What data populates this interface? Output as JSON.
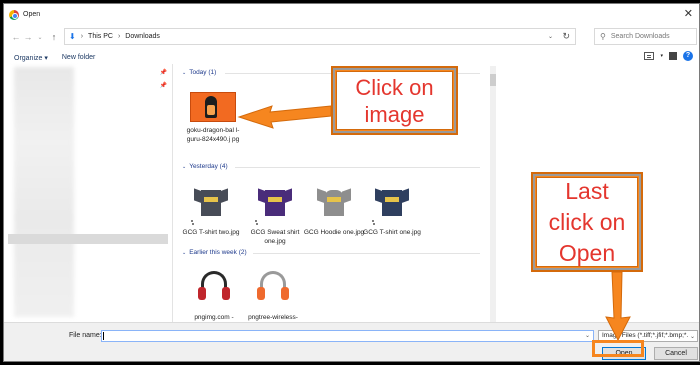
{
  "window": {
    "title": "Open"
  },
  "address": {
    "crumbs": [
      "This PC",
      "Downloads"
    ],
    "search_placeholder": "Search Downloads"
  },
  "toolbar": {
    "organize": "Organize",
    "new_folder": "New folder"
  },
  "groups": [
    {
      "label": "Today (1)"
    },
    {
      "label": "Yesterday (4)"
    },
    {
      "label": "Earlier this week (2)"
    }
  ],
  "files": {
    "today": [
      {
        "name": "goku-dragon-bal l-guru-824x490.j pg"
      }
    ],
    "yesterday": [
      {
        "name": "GCG T-shirt two.jpg",
        "color": "#474c57"
      },
      {
        "name": "GCG Sweat shirt one.jpg",
        "color": "#4a2c7a"
      },
      {
        "name": "GCG Hoodie one.jpg",
        "color": "#8e8e8e"
      },
      {
        "name": "GCG T-shirt one.jpg",
        "color": "#2f3f5f"
      }
    ],
    "earlier": [
      {
        "name": "pngimg.com -"
      },
      {
        "name": "pngtree-wireless-"
      }
    ]
  },
  "bottom": {
    "file_name_label": "File name:",
    "file_name_value": "",
    "file_type": "Image Files (*.tiff;*.jfif;*.bmp;*.g",
    "open_button": "Open",
    "cancel_button": "Cancel"
  },
  "annotations": {
    "click_image": "Click on\nimage",
    "last_click": "Last\nclick on\nOpen",
    "color": "#f6861f"
  }
}
